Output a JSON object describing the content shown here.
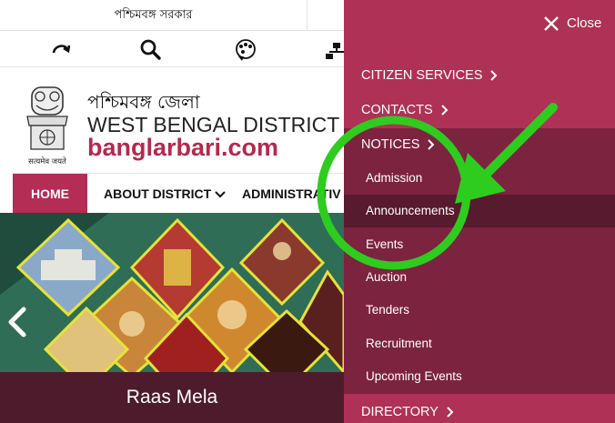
{
  "header": {
    "gov_label": "পশ্চিমবঙ্গ সরকার",
    "site_title_bn": "পশ্চিমবঙ্গ জেলা",
    "site_title_en": "WEST BENGAL DISTRICT",
    "site_domain": "banglarbari.com",
    "emblem_motto": "सत्यमेव जयते",
    "icons": [
      "skip-to-content-icon",
      "search-icon",
      "accessibility-icon",
      "sitemap-icon"
    ]
  },
  "nav": {
    "home": "HOME",
    "about": "ABOUT DISTRICT",
    "admin": "ADMINISTRATIV"
  },
  "banner": {
    "caption": "Raas Mela"
  },
  "menu": {
    "close_label": "Close",
    "citizen_services": "CITIZEN SERVICES",
    "contacts": "CONTACTS",
    "notices": "NOTICES",
    "directory": "DIRECTORY",
    "notice_items": [
      "Admission",
      "Announcements",
      "Events",
      "Auction",
      "Tenders",
      "Recruitment",
      "Upcoming Events"
    ],
    "active_item": "Announcements"
  },
  "colors": {
    "brand": "#b32d54",
    "menu_bg": "#b03156",
    "submenu_bg": "#7c2340",
    "caption_bg": "#4d1b2c",
    "annotation": "#2ecc1f"
  }
}
